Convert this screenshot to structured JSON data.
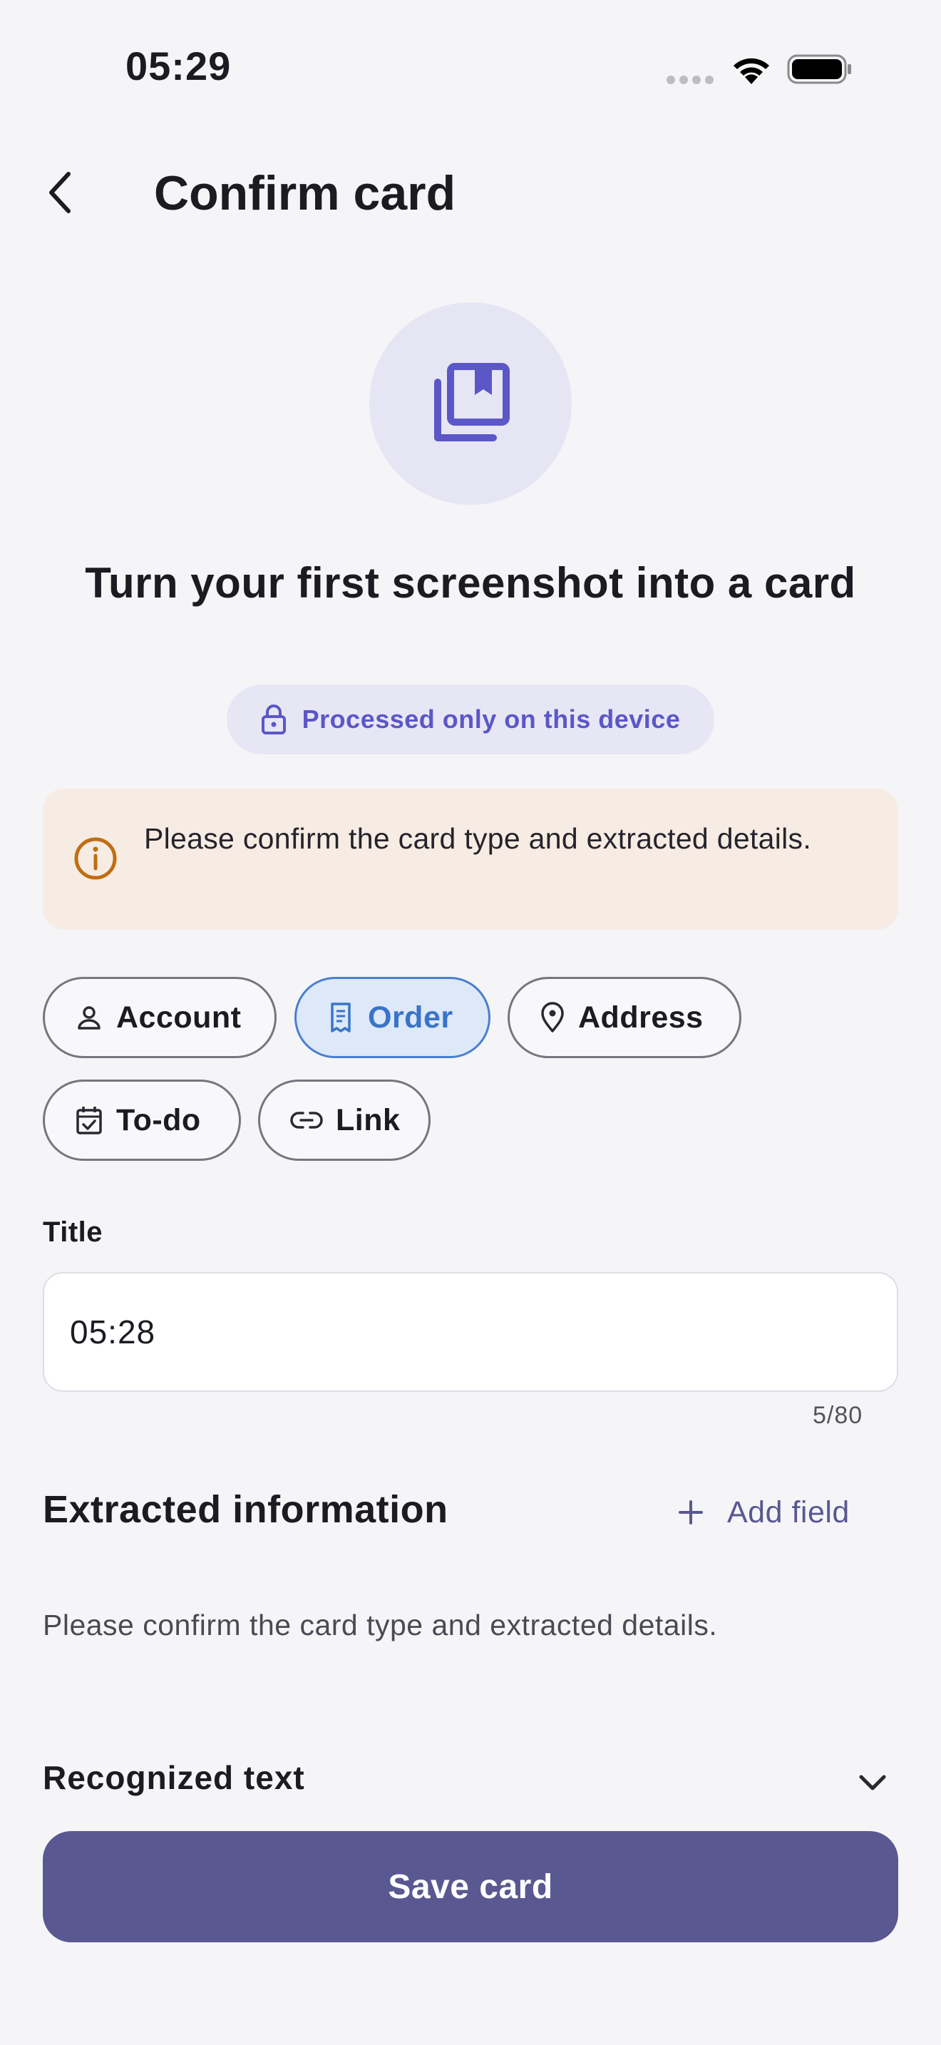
{
  "status_bar": {
    "time": "05:29"
  },
  "header": {
    "title": "Confirm card"
  },
  "hero": {
    "icon": "bookmark-stack-icon",
    "headline": "Turn your first screenshot into a card",
    "privacy_label": "Processed only on this device"
  },
  "notice": {
    "text": "Please confirm the card type and extracted details."
  },
  "card_types": [
    {
      "label": "Account",
      "icon": "person-icon",
      "selected": false
    },
    {
      "label": "Order",
      "icon": "receipt-icon",
      "selected": true
    },
    {
      "label": "Address",
      "icon": "location-pin-icon",
      "selected": false
    },
    {
      "label": "To-do",
      "icon": "calendar-check-icon",
      "selected": false
    },
    {
      "label": "Link",
      "icon": "link-icon",
      "selected": false
    }
  ],
  "title_field": {
    "label": "Title",
    "value": "05:28",
    "counter": "5/80"
  },
  "extracted": {
    "title": "Extracted information",
    "add_field_label": "Add field",
    "empty_text": "Please confirm the card type and extracted details."
  },
  "recognized": {
    "title": "Recognized text"
  },
  "save_label": "Save card",
  "colors": {
    "accent": "#5a5891",
    "selected_chip": "#3a74c9",
    "warning": "#c06d12",
    "privacy": "#5b57c7"
  }
}
